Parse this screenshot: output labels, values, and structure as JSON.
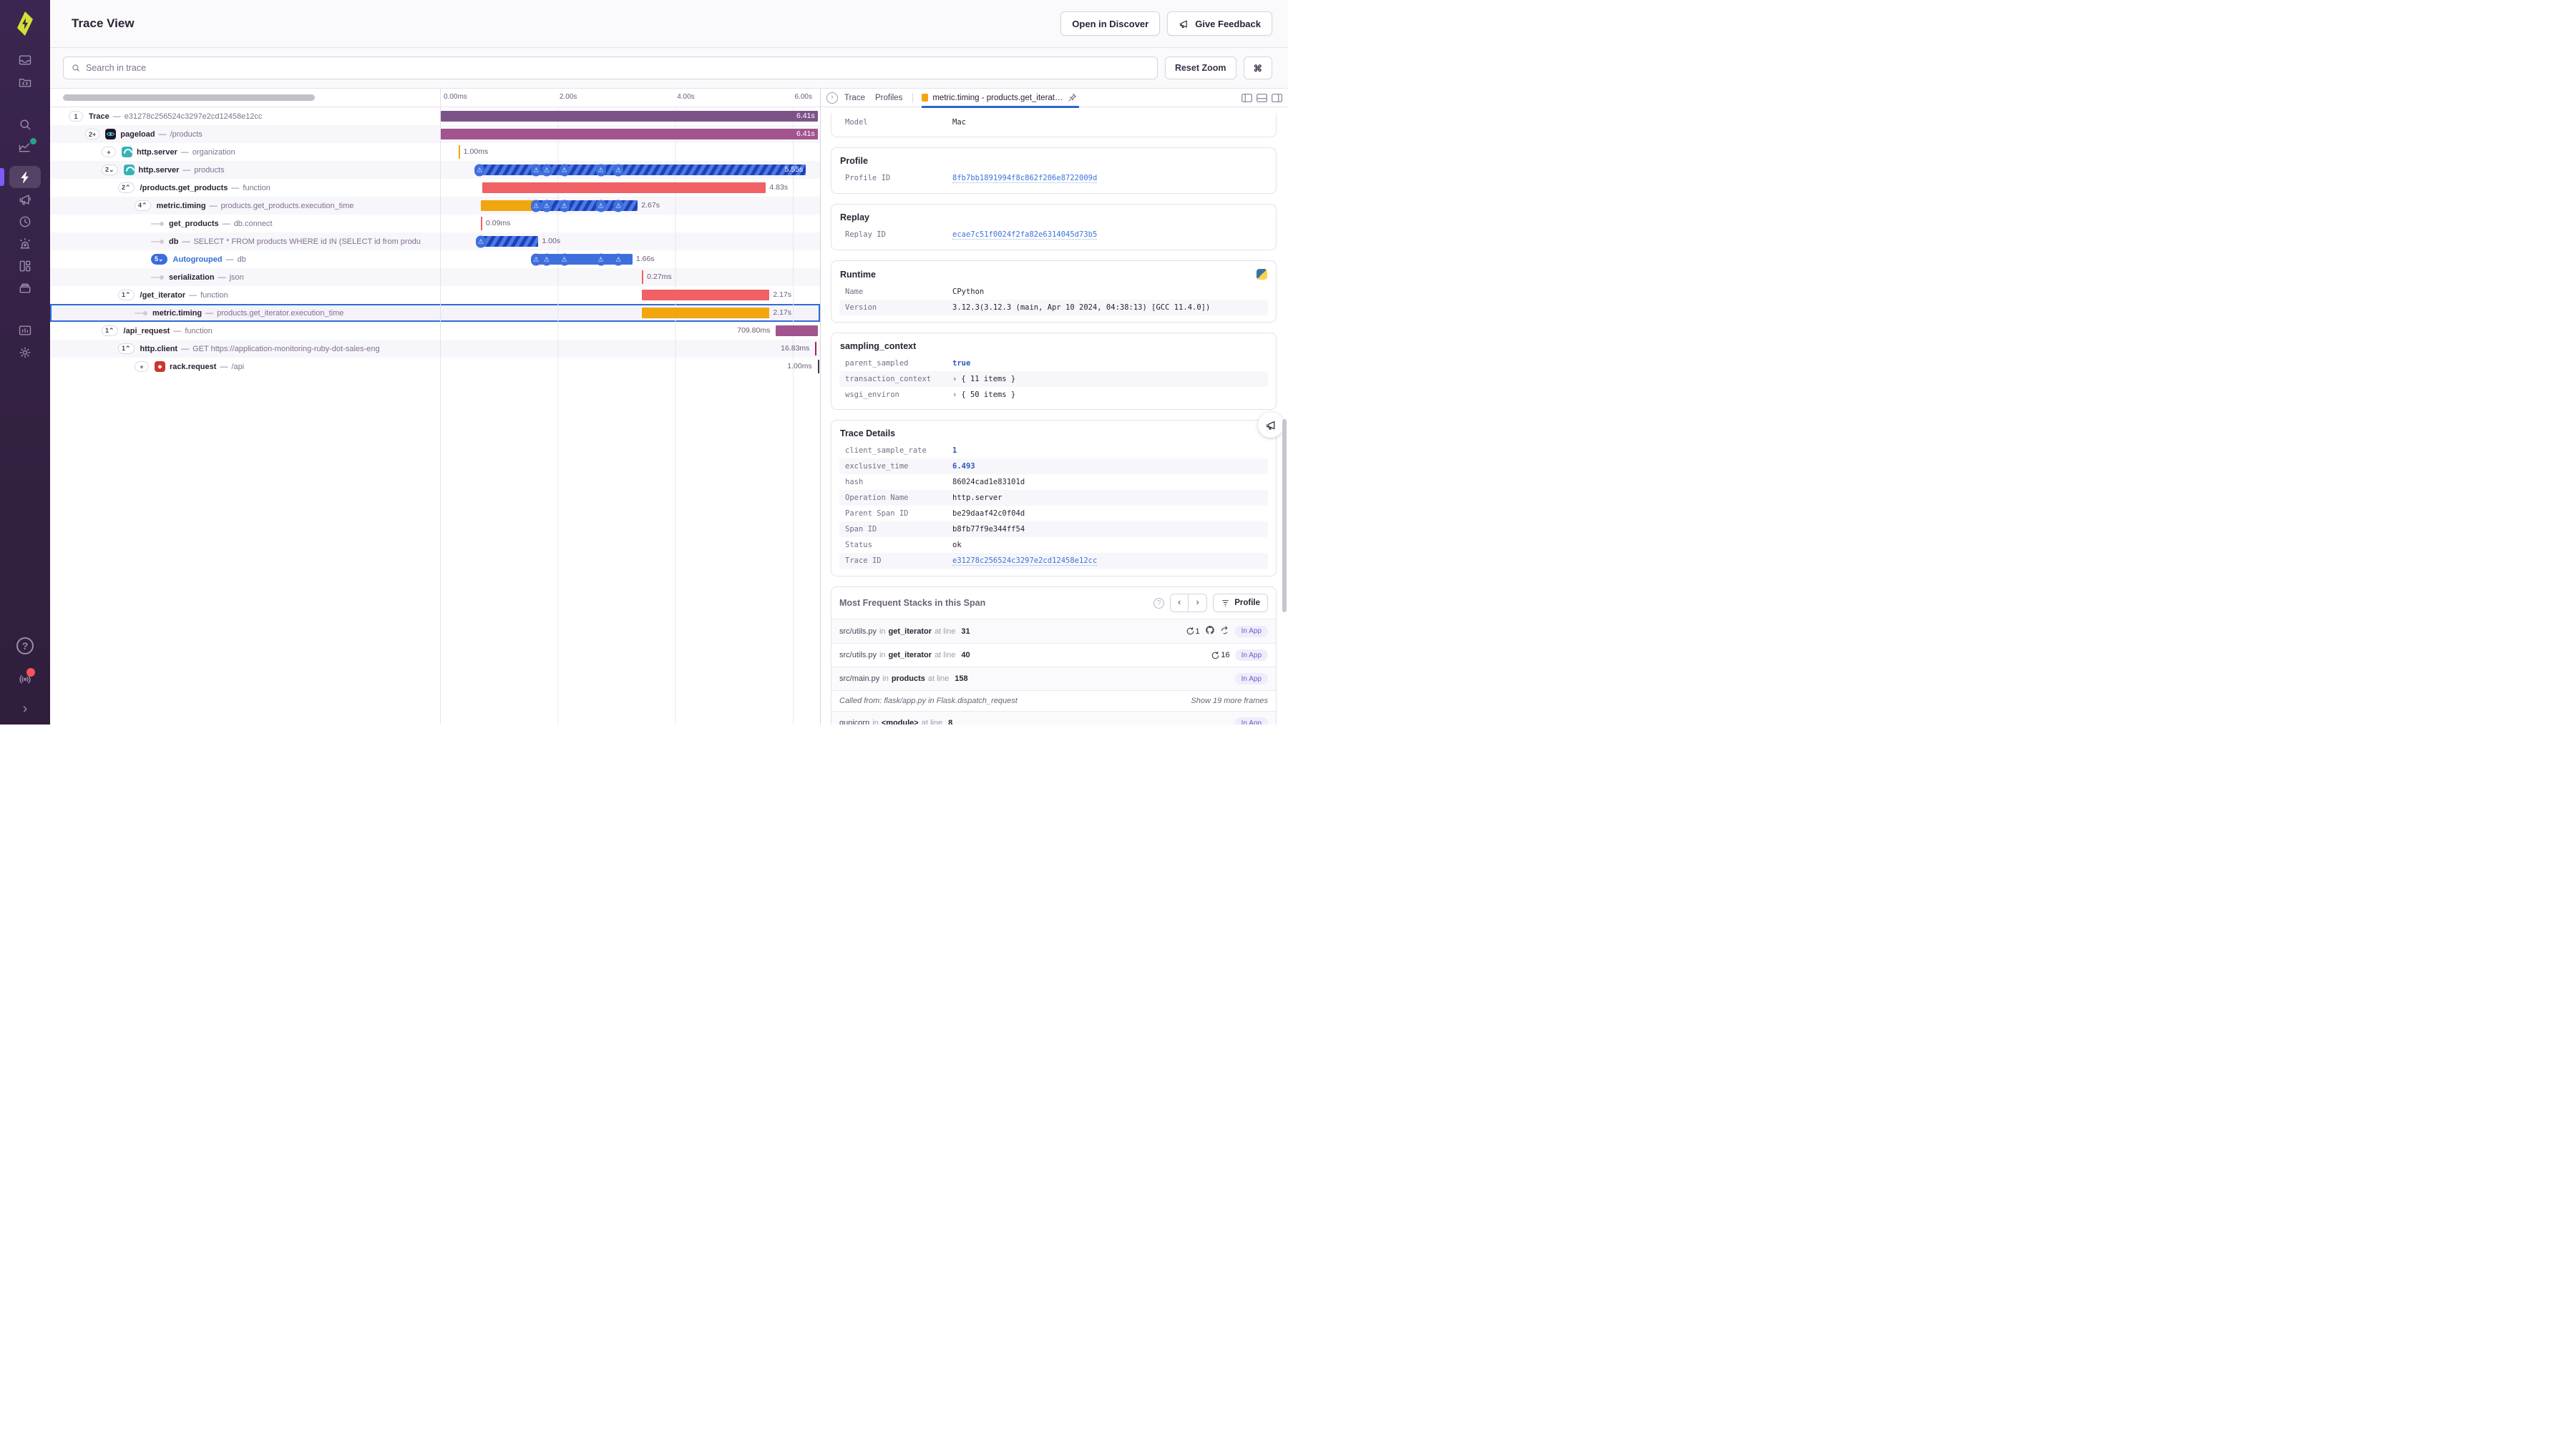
{
  "app": {
    "title": "Trace View",
    "open_in_discover": "Open in Discover",
    "give_feedback": "Give Feedback"
  },
  "toolbar": {
    "search_placeholder": "Search in trace",
    "reset_zoom": "Reset Zoom",
    "shortcut_key": "⌘"
  },
  "sidebar": {
    "icons": [
      "issues",
      "projects",
      "search",
      "stats",
      "performance",
      "feedback",
      "replays",
      "alerts",
      "dashboards",
      "releases",
      "usage-stats",
      "settings",
      "help",
      "whats-new",
      "expand"
    ],
    "active_icon": "performance",
    "accent_color": "#7a5cff",
    "background_color": "#36224a"
  },
  "timeline": {
    "ticks": [
      "0.00ms",
      "2.00s",
      "4.00s",
      "6.00s"
    ],
    "total_seconds": 6.45
  },
  "spans": [
    {
      "badge": "1",
      "title": "Trace",
      "subtitle": "e31278c256524c3297e2cd12458e12cc",
      "level": 0,
      "bar": {
        "segments": [
          {
            "start": 0,
            "dur": 6.41,
            "color": "purple"
          }
        ],
        "label": "6.41s",
        "label_pos": "inside"
      }
    },
    {
      "badge": "2+",
      "icon": "react",
      "title": "pageload",
      "subtitle": "/products",
      "level": 1,
      "bar": {
        "segments": [
          {
            "start": 0,
            "dur": 6.41,
            "color": "magenta"
          }
        ],
        "label": "6.41s",
        "label_pos": "inside"
      }
    },
    {
      "badge": "+",
      "icon": "python-sq",
      "title": "http.server",
      "subtitle": "organization",
      "level": 2,
      "bar": {
        "tick": {
          "at": 0.3,
          "color": "orange"
        },
        "label": "1.00ms",
        "label_pos": "right"
      }
    },
    {
      "badge": "2⌄",
      "icon": "python-sq",
      "title": "http.server",
      "subtitle": "products",
      "level": 2,
      "bar": {
        "segments": [
          {
            "start": 0.66,
            "dur": 5.55,
            "color": "hatch"
          }
        ],
        "label": "5.55s",
        "label_pos": "inside",
        "warnings": [
          0.66,
          1.62,
          1.8,
          2.1,
          2.72,
          3.02
        ]
      }
    },
    {
      "badge": "2⌃",
      "title": "/products.get_products",
      "subtitle": "function",
      "level": 3,
      "bar": {
        "segments": [
          {
            "start": 0.7,
            "dur": 4.83,
            "color": "red"
          }
        ],
        "label": "4.83s",
        "label_pos": "right"
      }
    },
    {
      "badge": "4⌃",
      "title": "metric.timing",
      "subtitle": "products.get_products.execution_time",
      "level": 4,
      "bar": {
        "segments": [
          {
            "start": 0.68,
            "dur": 0.92,
            "color": "orange"
          },
          {
            "start": 1.6,
            "dur": 1.75,
            "color": "hatch"
          }
        ],
        "label": "2.67s",
        "label_pos": "right",
        "warnings": [
          1.62,
          1.8,
          2.1,
          2.72,
          3.02
        ]
      }
    },
    {
      "leaf": true,
      "title": "get_products",
      "subtitle": "db.connect",
      "level": 5,
      "bar": {
        "tick": {
          "at": 0.68,
          "color": "red"
        },
        "label": "0.09ms",
        "label_pos": "right"
      }
    },
    {
      "leaf": true,
      "title": "db",
      "subtitle": "SELECT * FROM products WHERE id IN (SELECT id from produ",
      "level": 5,
      "bar": {
        "segments": [
          {
            "start": 0.66,
            "dur": 1.0,
            "color": "hatch"
          }
        ],
        "label": "1.00s",
        "label_pos": "right",
        "warnings": [
          0.68
        ]
      }
    },
    {
      "badge": "5⌄",
      "badge_blue": true,
      "title": "Autogrouped",
      "title_blue": true,
      "subtitle": "db",
      "level": 5,
      "bar": {
        "segments": [
          {
            "start": 1.6,
            "dur": 1.66,
            "color": "blue"
          }
        ],
        "label": "1.66s",
        "label_pos": "right",
        "warnings": [
          1.62,
          1.8,
          2.1,
          2.72,
          3.02
        ]
      }
    },
    {
      "leaf": true,
      "title": "serialization",
      "subtitle": "json",
      "level": 5,
      "bar": {
        "tick": {
          "at": 3.42,
          "color": "red"
        },
        "label": "0.27ms",
        "label_pos": "right"
      }
    },
    {
      "badge": "1⌃",
      "title": "/get_iterator",
      "subtitle": "function",
      "level": 3,
      "bar": {
        "segments": [
          {
            "start": 3.42,
            "dur": 2.17,
            "color": "red"
          }
        ],
        "label": "2.17s",
        "label_pos": "right"
      }
    },
    {
      "leaf": true,
      "selected": true,
      "title": "metric.timing",
      "subtitle": "products.get_iterator.execution_time",
      "level": 4,
      "bar": {
        "segments": [
          {
            "start": 3.42,
            "dur": 2.17,
            "color": "orange"
          }
        ],
        "label": "2.17s",
        "label_pos": "right"
      }
    },
    {
      "badge": "1⌃",
      "title": "/api_request",
      "subtitle": "function",
      "level": 2,
      "bar": {
        "segments": [
          {
            "start": 5.7,
            "dur": 0.71,
            "color": "magenta"
          }
        ],
        "label": "709.80ms",
        "label_pos": "left"
      }
    },
    {
      "badge": "1⌃",
      "title": "http.client",
      "subtitle": "GET https://application-monitoring-ruby-dot-sales-eng",
      "level": 3,
      "bar": {
        "tick": {
          "at": 6.37,
          "color": "maroon"
        },
        "label": "16.83ms",
        "label_pos": "left"
      }
    },
    {
      "badge": "+",
      "icon": "ruby",
      "title": "rack.request",
      "subtitle": "/api",
      "level": 4,
      "bar": {
        "tick": {
          "at": 6.41,
          "color": "dark"
        },
        "label": "1.00ms",
        "label_pos": "left"
      }
    }
  ],
  "tabs": {
    "collapse": "›",
    "items": [
      "Trace",
      "Profiles"
    ],
    "active_label": "metric.timing - products.get_iterat…",
    "active_color": "#f2a60e"
  },
  "cards": [
    {
      "clipped": true,
      "rows": [
        {
          "k": "Model",
          "v": "Mac"
        }
      ]
    },
    {
      "title": "Profile",
      "rows": [
        {
          "k": "Profile ID",
          "v": "8fb7bb1891994f8c862f206e8722009d",
          "link": true
        }
      ]
    },
    {
      "title": "Replay",
      "rows": [
        {
          "k": "Replay ID",
          "v": "ecae7c51f0024f2fa82e6314045d73b5",
          "link": true
        }
      ]
    },
    {
      "title": "Runtime",
      "icon": "python",
      "rows": [
        {
          "k": "Name",
          "v": "CPython"
        },
        {
          "k": "Version",
          "v": "3.12.3(3.12.3 (main, Apr 10 2024, 04:38:13) [GCC 11.4.0])"
        }
      ]
    },
    {
      "title": "sampling_context",
      "rows": [
        {
          "k": "parent_sampled",
          "v": "true",
          "blue": true
        },
        {
          "k": "transaction_context",
          "v": "{ 11 items }",
          "expand": "›"
        },
        {
          "k": "wsgi_environ",
          "v": "{ 50 items }",
          "expand": "›"
        }
      ]
    },
    {
      "title": "Trace Details",
      "rows": [
        {
          "k": "client_sample_rate",
          "v": "1",
          "blue": true
        },
        {
          "k": "exclusive_time",
          "v": "6.493",
          "blue": true
        },
        {
          "k": "hash",
          "v": "86024cad1e83101d"
        },
        {
          "k": "Operation Name",
          "v": "http.server"
        },
        {
          "k": "Parent Span ID",
          "v": "be29daaf42c0f04d"
        },
        {
          "k": "Span ID",
          "v": "b8fb77f9e344ff54"
        },
        {
          "k": "Status",
          "v": "ok"
        },
        {
          "k": "Trace ID",
          "v": "e31278c256524c3297e2cd12458e12cc",
          "link": true
        }
      ]
    }
  ],
  "stacks": {
    "title": "Most Frequent Stacks in this Span",
    "profile_button": "Profile",
    "in_word": "in",
    "line_word": "at line",
    "rows": [
      {
        "file": "src/utils.py",
        "fn": "get_iterator",
        "line": "31",
        "count": "1",
        "vcs": [
          "github",
          "source-link"
        ],
        "badge": "In App"
      },
      {
        "file": "src/utils.py",
        "fn": "get_iterator",
        "line": "40",
        "count": "16",
        "badge": "In App"
      },
      {
        "file": "src/main.py",
        "fn": "products",
        "line": "158",
        "badge": "In App"
      },
      {
        "note": "Called from: flask/app.py in Flask.dispatch_request",
        "more": "Show 19 more frames"
      },
      {
        "file": "gunicorn",
        "fn": "<module>",
        "line": "8",
        "badge": "In App"
      }
    ]
  }
}
